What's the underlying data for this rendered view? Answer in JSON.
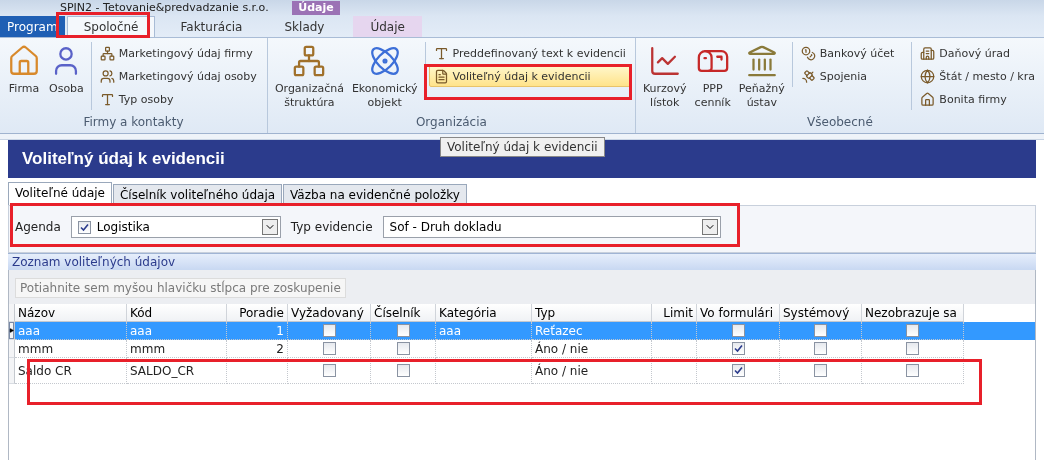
{
  "window": {
    "title": "SPIN2 - Tetovanie&predvadzanie s.r.o.",
    "context_header": "Údaje"
  },
  "ribbon": {
    "tabs": [
      {
        "label": "Program",
        "kind": "app",
        "selected": false
      },
      {
        "label": "Spoločné",
        "kind": "normal",
        "selected": true
      },
      {
        "label": "Fakturácia",
        "kind": "normal",
        "selected": false
      },
      {
        "label": "Sklady",
        "kind": "normal",
        "selected": false
      },
      {
        "label": "Údaje",
        "kind": "context",
        "selected": false
      }
    ],
    "groups": [
      {
        "label": "Firmy a kontakty",
        "items": [
          {
            "kind": "large",
            "label": "Firma"
          },
          {
            "kind": "large",
            "label": "Osoba"
          },
          {
            "kind": "column",
            "items": [
              {
                "label": "Marketingový údaj firmy",
                "highlighted": false
              },
              {
                "label": "Marketingový údaj osoby",
                "highlighted": false
              },
              {
                "label": "Typ osoby",
                "highlighted": false
              }
            ]
          }
        ]
      },
      {
        "label": "Organizácia",
        "items": [
          {
            "kind": "large",
            "label": "Organizačná štruktúra"
          },
          {
            "kind": "large",
            "label": "Ekonomický objekt"
          },
          {
            "kind": "column",
            "items": [
              {
                "label": "Preddefinovaný text k evidencii",
                "highlighted": false
              },
              {
                "label": "Voliteľný údaj k evidencii",
                "highlighted": true
              }
            ]
          }
        ]
      },
      {
        "label": "Všeobecné",
        "items": [
          {
            "kind": "large",
            "label": "Kurzový lístok"
          },
          {
            "kind": "large",
            "label": "PPP cenník"
          },
          {
            "kind": "large",
            "label": "Peňažný ústav"
          },
          {
            "kind": "column",
            "items": [
              {
                "label": "Bankový účet",
                "highlighted": false
              },
              {
                "label": "Spojenia",
                "highlighted": false
              }
            ]
          },
          {
            "kind": "column",
            "items": [
              {
                "label": "Daňový úrad",
                "highlighted": false
              },
              {
                "label": "Štát / mesto / kra",
                "highlighted": false
              },
              {
                "label": "Bonita firmy",
                "highlighted": false
              }
            ]
          }
        ]
      }
    ]
  },
  "form": {
    "title": "Voliteľný údaj k evidencii",
    "tooltip": "Voliteľný údaj k evidencii",
    "tabs": [
      {
        "label": "Voliteľné údaje",
        "selected": true
      },
      {
        "label": "Číselník voliteľného údaja",
        "selected": false
      },
      {
        "label": "Väzba na evidenčné položky",
        "selected": false
      }
    ],
    "agenda": {
      "label": "Agenda",
      "checked": true,
      "value": "Logistika"
    },
    "typ_evidencie": {
      "label": "Typ evidencie",
      "value": "Sof - Druh dokladu"
    },
    "section": "Zoznam voliteľných údajov",
    "group_hint": "Potiahnite sem myšou hlavičku stĺpca pre zoskupenie",
    "table": {
      "columns": [
        {
          "label": "Názov",
          "kind": "text"
        },
        {
          "label": "Kód",
          "kind": "text"
        },
        {
          "label": "Poradie",
          "kind": "number"
        },
        {
          "label": "Vyžadovaný",
          "kind": "check"
        },
        {
          "label": "Číselník",
          "kind": "check"
        },
        {
          "label": "Kategória",
          "kind": "text"
        },
        {
          "label": "Typ",
          "kind": "text"
        },
        {
          "label": "Limit",
          "kind": "number"
        },
        {
          "label": "Vo formulári",
          "kind": "check"
        },
        {
          "label": "Systémový",
          "kind": "check"
        },
        {
          "label": "Nezobrazuje sa",
          "kind": "check"
        }
      ],
      "rows": [
        {
          "selected": true,
          "current": true,
          "cells": [
            "aaa",
            "aaa",
            "1",
            false,
            false,
            "aaa",
            "Reťazec",
            "",
            false,
            false,
            false
          ]
        },
        {
          "selected": false,
          "current": false,
          "cells": [
            "mmm",
            "mmm",
            "2",
            false,
            false,
            "",
            "Áno / nie",
            "",
            true,
            false,
            false
          ]
        },
        {
          "selected": false,
          "current": false,
          "cells": [
            "Saldo CR",
            "SALDO_CR",
            "",
            false,
            false,
            "",
            "Áno / nie",
            "",
            true,
            false,
            false
          ]
        }
      ]
    }
  }
}
